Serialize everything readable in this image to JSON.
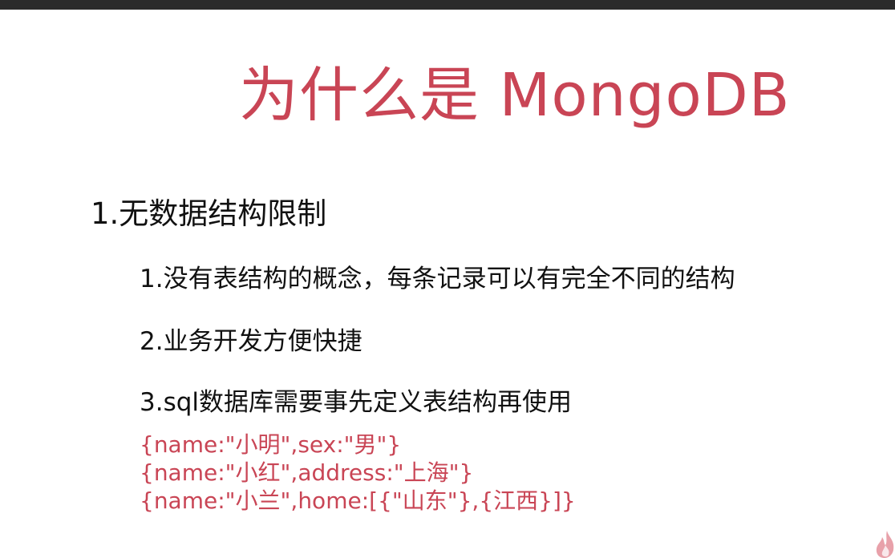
{
  "slide": {
    "title": "为什么是 MongoDB",
    "heading": "1.无数据结构限制",
    "points": [
      "1.没有表结构的概念，每条记录可以有完全不同的结构",
      "2.业务开发方便快捷",
      "3.sql数据库需要事先定义表结构再使用"
    ],
    "code_lines": [
      "{name:\"小明\",sex:\"男\"}",
      "{name:\"小红\",address:\"上海\"}",
      "{name:\"小兰\",home:[{\"山东\"},{江西}]}"
    ]
  },
  "colors": {
    "accent": "#c94555",
    "text": "#111111",
    "top_bar": "#2b2b2b",
    "background": "#ffffff"
  },
  "icons": {
    "corner": "flame-icon"
  }
}
